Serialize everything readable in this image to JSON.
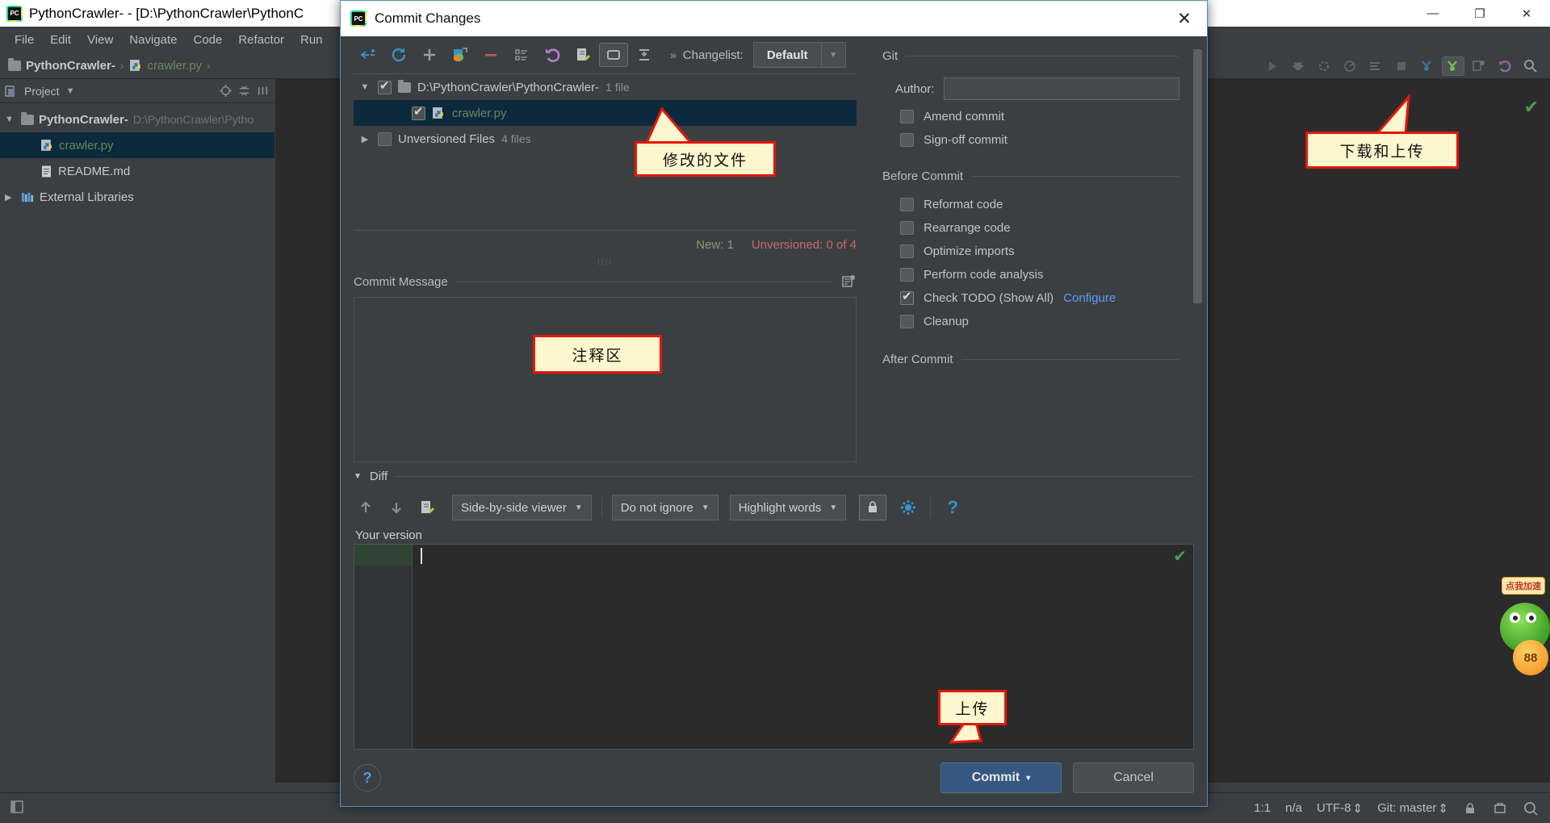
{
  "ide": {
    "title": "PythonCrawler- - [D:\\PythonCrawler\\PythonC",
    "window_controls": {
      "minimize": "—",
      "maximize": "❐",
      "close": "✕"
    },
    "menu": [
      "File",
      "Edit",
      "View",
      "Navigate",
      "Code",
      "Refactor",
      "Run"
    ],
    "breadcrumb": {
      "project": "PythonCrawler-",
      "file": "crawler.py",
      "sep": "›"
    },
    "project_panel": {
      "label": "Project",
      "chevron": "▼"
    },
    "tree": [
      {
        "arrow": "▼",
        "name": "PythonCrawler-",
        "path": "D:\\PythonCrawler\\Pytho",
        "kind": "folder",
        "selected": false
      },
      {
        "arrow": "",
        "name": "crawler.py",
        "path": "",
        "kind": "python",
        "selected": true
      },
      {
        "arrow": "",
        "name": "README.md",
        "path": "",
        "kind": "md",
        "selected": false
      },
      {
        "arrow": "▶",
        "name": "External Libraries",
        "path": "",
        "kind": "lib",
        "selected": false
      }
    ],
    "status": {
      "left": "",
      "caret": "1:1",
      "indent": "n/a",
      "encoding": "UTF-8",
      "encoding_arrow": "⇕",
      "branch": "Git: master",
      "branch_arrow": "⇕",
      "lock_icon": "lock-icon",
      "inspector_icon": "inspector-icon",
      "search_icon": "magnifier-icon"
    },
    "ad_widget": {
      "bubble": "点我加速",
      "badge": "88"
    }
  },
  "dialog": {
    "title": "Commit Changes",
    "close": "✕",
    "toolbar_icons": [
      "show-diff-icon",
      "refresh-icon",
      "add-icon",
      "revert-selected-icon",
      "delete-icon",
      "group-by-icon",
      "rollback-icon",
      "edit-source-icon",
      "group-by-directory-icon",
      "collapse-all-icon"
    ],
    "changelist": {
      "chevrons": "»",
      "label": "Changelist:",
      "value": "Default",
      "arrow": "▼"
    },
    "tree": [
      {
        "arrow": "▼",
        "checked": true,
        "icon": "folder-icon",
        "name": "D:\\PythonCrawler\\PythonCrawler-",
        "sub": "1 file",
        "selected": false
      },
      {
        "arrow": "",
        "checked": true,
        "icon": "python-file-icon",
        "name": "crawler.py",
        "sub": "",
        "selected": true
      },
      {
        "arrow": "▶",
        "checked": false,
        "icon": "folder-grey-icon",
        "name": "Unversioned Files",
        "sub": "4 files",
        "selected": false
      }
    ],
    "counts": {
      "new": "New: 1",
      "unversioned": "Unversioned: 0 of 4"
    },
    "commit_message": {
      "label": "Commit Message",
      "value": "",
      "history_icon": "message-history-icon"
    },
    "git": {
      "group_label": "Git",
      "author_label": "Author:",
      "author_value": "",
      "author_placeholder": "",
      "checkboxes": [
        {
          "label": "Amend commit",
          "checked": false
        },
        {
          "label": "Sign-off commit",
          "checked": false
        }
      ]
    },
    "before_commit": {
      "group_label": "Before Commit",
      "checkboxes": [
        {
          "label": "Reformat code",
          "checked": false,
          "link": ""
        },
        {
          "label": "Rearrange code",
          "checked": false,
          "link": ""
        },
        {
          "label": "Optimize imports",
          "checked": false,
          "link": ""
        },
        {
          "label": "Perform code analysis",
          "checked": false,
          "link": ""
        },
        {
          "label": "Check TODO (Show All)",
          "checked": true,
          "link": "Configure"
        },
        {
          "label": "Cleanup",
          "checked": false,
          "link": ""
        }
      ]
    },
    "after_commit": {
      "group_label": "After Commit"
    },
    "diff": {
      "label": "Diff",
      "triangle": "▼",
      "prev_icon": "arrow-up-icon",
      "next_icon": "arrow-down-icon",
      "edit_icon": "edit-source-icon",
      "viewer_mode": "Side-by-side viewer",
      "whitespace_mode": "Do not ignore",
      "highlight_mode": "Highlight words",
      "lock_icon": "lock-icon",
      "settings_icon": "gear-icon",
      "help_icon": "question-icon",
      "your_version_label": "Your version"
    },
    "footer": {
      "help": "?",
      "commit_label": "Commit",
      "commit_arrow": "▾",
      "cancel_label": "Cancel"
    }
  },
  "annotations": [
    {
      "id": "modified-file",
      "text": "修改的文件"
    },
    {
      "id": "comment-area",
      "text": "注释区"
    },
    {
      "id": "upload",
      "text": "上传"
    },
    {
      "id": "download-upload",
      "text": "下载和上传"
    }
  ]
}
